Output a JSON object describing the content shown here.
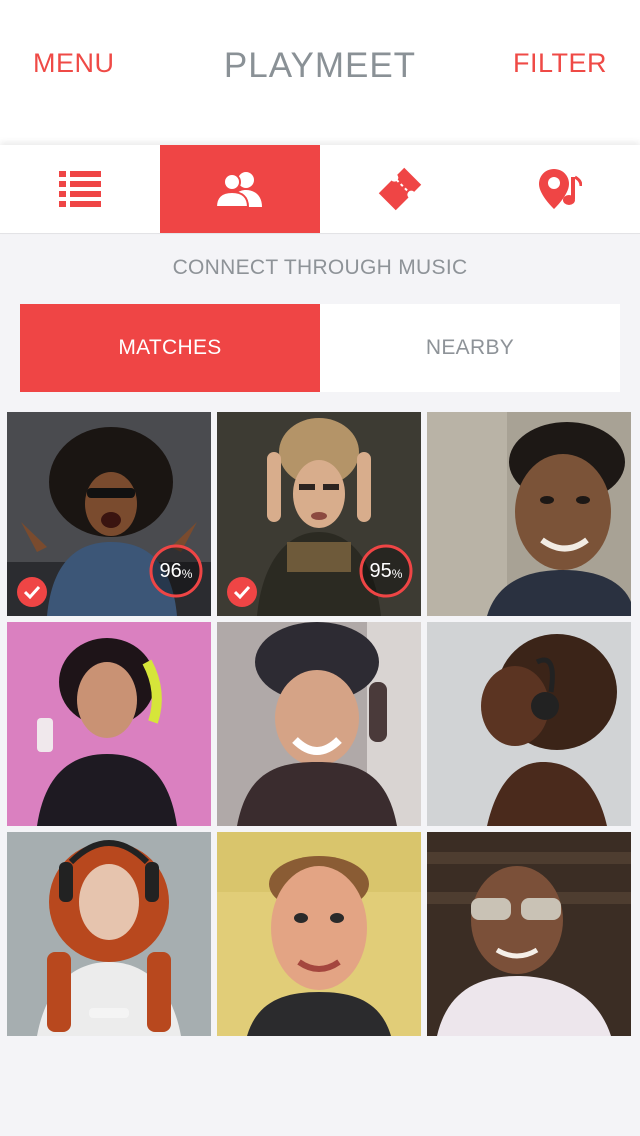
{
  "header": {
    "menu_label": "MENU",
    "title": "PLAYMEET",
    "filter_label": "FILTER"
  },
  "tabs": [
    {
      "icon": "list-icon",
      "active": false
    },
    {
      "icon": "people-icon",
      "active": true
    },
    {
      "icon": "ticket-icon",
      "active": false
    },
    {
      "icon": "location-music-icon",
      "active": false
    }
  ],
  "subtitle": "CONNECT THROUGH MUSIC",
  "segment": {
    "matches_label": "MATCHES",
    "nearby_label": "NEARBY",
    "selected": "MATCHES"
  },
  "profiles": [
    {
      "match_value": "96",
      "match_unit": "%",
      "match_fraction": 0.96,
      "checked": true
    },
    {
      "match_value": "95",
      "match_unit": "%",
      "match_fraction": 0.95,
      "checked": true
    },
    {
      "checked": false
    },
    {
      "checked": false
    },
    {
      "checked": false
    },
    {
      "checked": false
    },
    {
      "checked": false
    },
    {
      "checked": false
    },
    {
      "checked": false
    }
  ],
  "colors": {
    "accent": "#ef4545",
    "background": "#f4f4f7",
    "muted_text": "#8e9398",
    "title_text": "#8a9196"
  }
}
